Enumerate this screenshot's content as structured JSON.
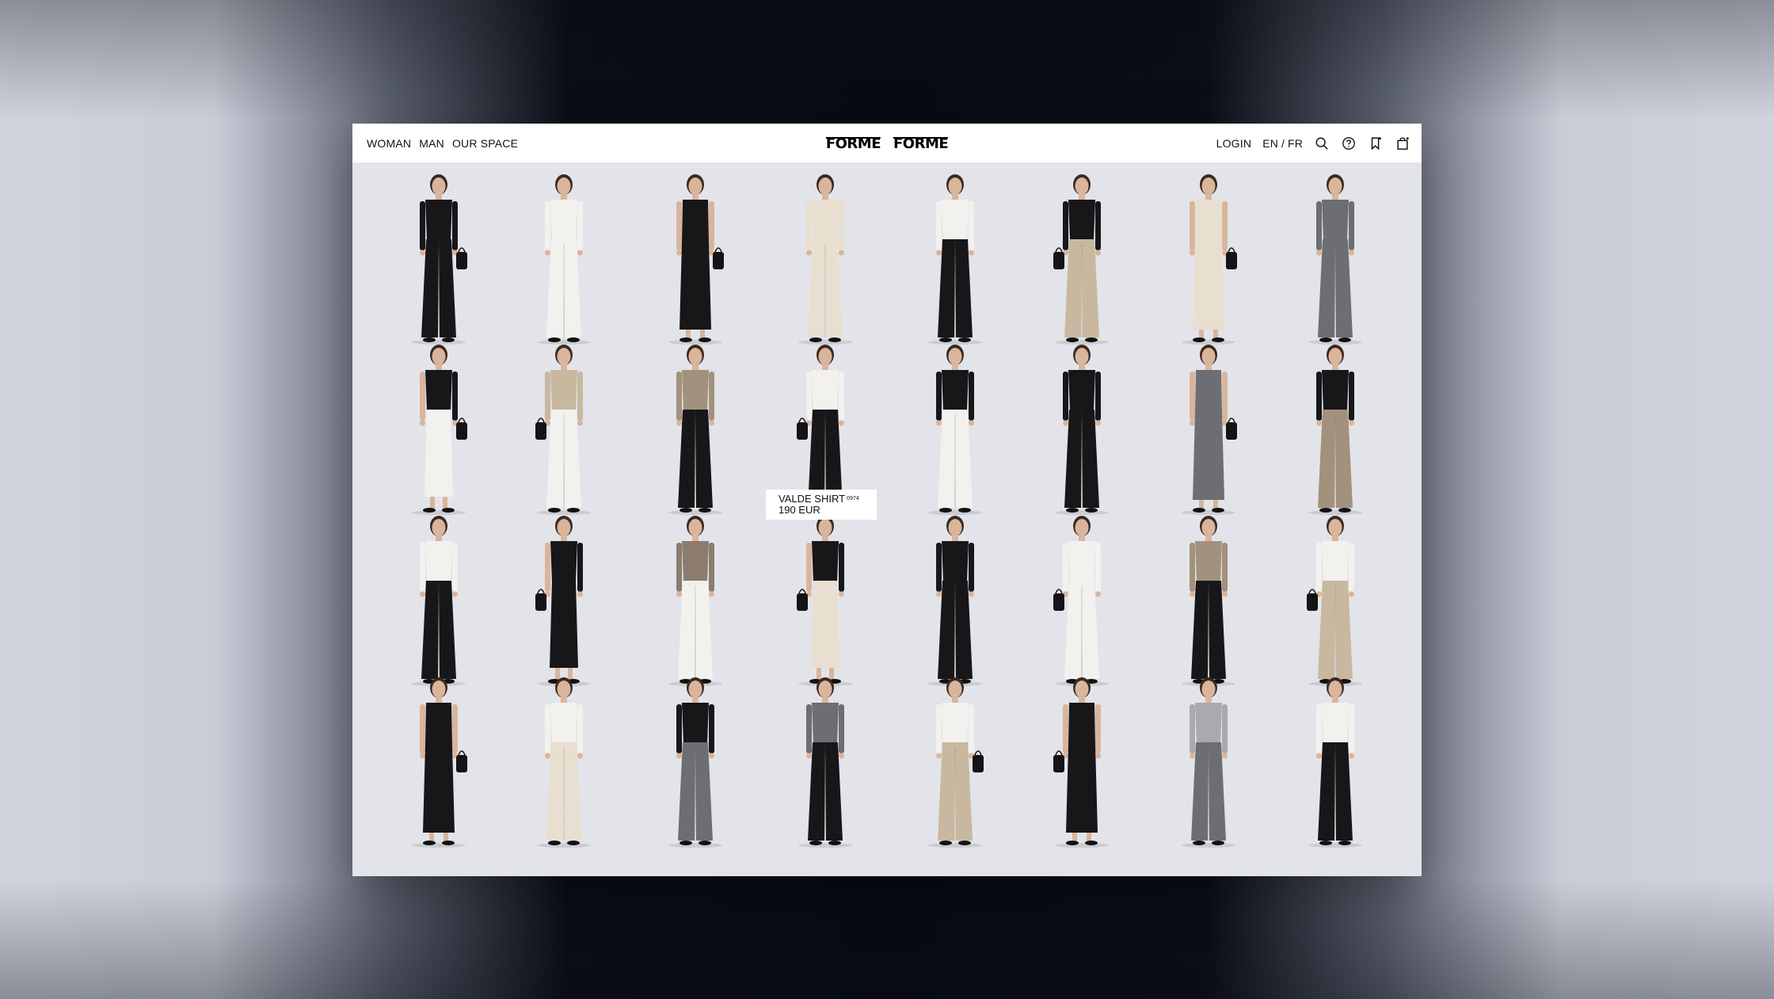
{
  "nav": {
    "left": [
      "WOMAN",
      "MAN",
      "OUR SPACE"
    ],
    "logo": [
      "FORME",
      "FORME"
    ],
    "login": "LOGIN",
    "lang_en": "EN",
    "lang_sep": "/",
    "lang_fr": "FR",
    "icons": [
      "search-icon",
      "help-icon",
      "bookmark-icon",
      "bag-icon"
    ]
  },
  "tooltip": {
    "name": "VALDE SHIRT",
    "code": "0974",
    "price": "190 EUR"
  },
  "palette": {
    "background": "#e3e4e9",
    "skin": "#d9b59c",
    "black": "#17171a",
    "white": "#f2f1ee",
    "cream": "#e8dfd0",
    "grey": "#6d6e73",
    "lightgrey": "#a9aaae",
    "taupe": "#a2917c",
    "sand": "#c7b89f",
    "brown": "#8b7c6e"
  },
  "products": [
    {
      "top": "black",
      "bottom": "black",
      "bag": true
    },
    {
      "top": "white",
      "bottom": "white",
      "bag": false
    },
    {
      "top": "black",
      "bottom": "black",
      "dress": true,
      "bag": true
    },
    {
      "top": "cream",
      "bottom": "cream",
      "bag": false
    },
    {
      "top": "white",
      "bottom": "black",
      "bag": false
    },
    {
      "top": "black",
      "bottom": "sand",
      "bag": true
    },
    {
      "top": "cream",
      "bottom": "cream",
      "dress": true,
      "bag": true
    },
    {
      "top": "grey",
      "bottom": "grey",
      "bag": false
    },
    {
      "top": "black",
      "bottom": "white",
      "skirt": true,
      "bag": true
    },
    {
      "top": "sand",
      "bottom": "white",
      "bag": true
    },
    {
      "top": "taupe",
      "bottom": "black",
      "bag": false
    },
    {
      "top": "white",
      "bottom": "black",
      "bag": true
    },
    {
      "top": "black",
      "bottom": "white",
      "bag": false
    },
    {
      "top": "black",
      "bottom": "black",
      "bag": false
    },
    {
      "top": "grey",
      "bottom": "grey",
      "dress": true,
      "bag": true
    },
    {
      "top": "black",
      "bottom": "taupe",
      "bag": false
    },
    {
      "top": "white",
      "bottom": "black",
      "bag": false
    },
    {
      "top": "black",
      "bottom": "black",
      "skirt": true,
      "bag": true
    },
    {
      "top": "brown",
      "bottom": "white",
      "bag": false
    },
    {
      "top": "black",
      "bottom": "cream",
      "skirt": true,
      "bag": true
    },
    {
      "top": "black",
      "bottom": "black",
      "bag": false
    },
    {
      "top": "white",
      "bottom": "white",
      "bag": true
    },
    {
      "top": "taupe",
      "bottom": "black",
      "bag": false
    },
    {
      "top": "white",
      "bottom": "sand",
      "bag": true
    },
    {
      "top": "black",
      "bottom": "black",
      "dress": true,
      "bag": true
    },
    {
      "top": "white",
      "bottom": "cream",
      "bag": false
    },
    {
      "top": "black",
      "bottom": "grey",
      "bag": false
    },
    {
      "top": "grey",
      "bottom": "black",
      "bag": false
    },
    {
      "top": "white",
      "bottom": "sand",
      "bag": true
    },
    {
      "top": "black",
      "bottom": "black",
      "dress": true,
      "bag": true
    },
    {
      "top": "lightgrey",
      "bottom": "grey",
      "bag": false
    },
    {
      "top": "white",
      "bottom": "black",
      "bag": false
    }
  ]
}
